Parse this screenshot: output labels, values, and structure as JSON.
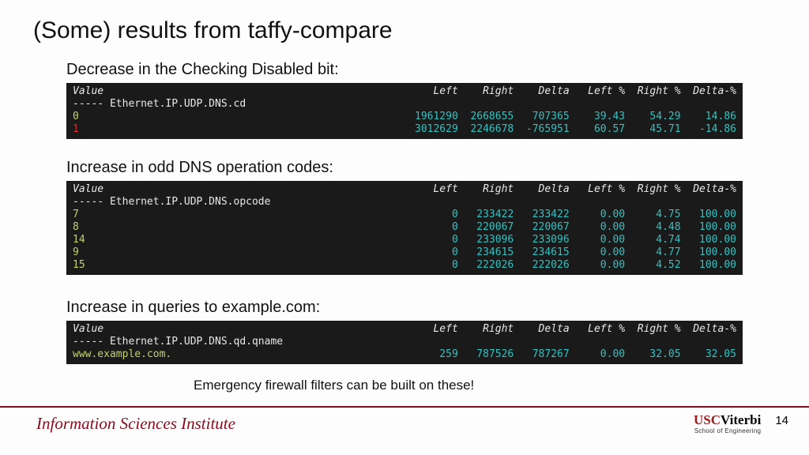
{
  "title": "(Some) results from taffy-compare",
  "sections": {
    "s1": {
      "sub": "Decrease in the Checking Disabled bit:",
      "path": "----- Ethernet.IP.UDP.DNS.cd"
    },
    "s2": {
      "sub": "Increase in odd DNS operation codes:",
      "path": "----- Ethernet.IP.UDP.DNS.opcode"
    },
    "s3": {
      "sub": "Increase in queries to example.com:",
      "path": "----- Ethernet.IP.UDP.DNS.qd.qname"
    }
  },
  "headers": {
    "value": "Value",
    "cols": "          Left    Right    Delta   Left %  Right %  Delta-%"
  },
  "t1": {
    "r0": {
      "v": "0",
      "d": "       1961290  2668655   707365    39.43    54.29    14.86"
    },
    "r1": {
      "v": "1",
      "d": "       3012629  2246678  -765951    60.57    45.71   -14.86"
    }
  },
  "t2": {
    "r0": {
      "v": "7",
      "d": "       0   233422   233422     0.00     4.75   100.00"
    },
    "r1": {
      "v": "8",
      "d": "       0   220067   220067     0.00     4.48   100.00"
    },
    "r2": {
      "v": "14",
      "d": "       0   233096   233096     0.00     4.74   100.00"
    },
    "r3": {
      "v": "9",
      "d": "       0   234615   234615     0.00     4.77   100.00"
    },
    "r4": {
      "v": "15",
      "d": "       0   222026   222026     0.00     4.52   100.00"
    }
  },
  "t3": {
    "r0": {
      "v": "www.example.com.",
      "d": "  259   787526   787267     0.00    32.05    32.05"
    }
  },
  "emergency": "Emergency firewall filters can be built on these!",
  "footer": {
    "isi": "Information Sciences Institute",
    "usc_prefix": "USC",
    "usc_suffix": "Viterbi",
    "soe": "School of Engineering",
    "page": "14"
  }
}
